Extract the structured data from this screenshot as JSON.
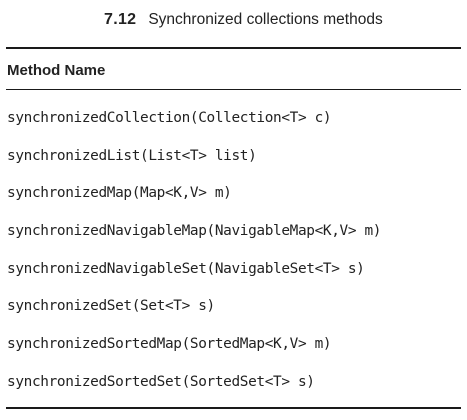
{
  "caption": {
    "number": "7.12",
    "title": "Synchronized collections methods"
  },
  "table": {
    "header": "Method Name",
    "rows": [
      "synchronizedCollection(Collection<T> c)",
      "synchronizedList(List<T> list)",
      "synchronizedMap(Map<K,V> m)",
      "synchronizedNavigableMap(NavigableMap<K,V> m)",
      "synchronizedNavigableSet(NavigableSet<T> s)",
      "synchronizedSet(Set<T> s)",
      "synchronizedSortedMap(SortedMap<K,V> m)",
      "synchronizedSortedSet(SortedSet<T> s)"
    ]
  }
}
